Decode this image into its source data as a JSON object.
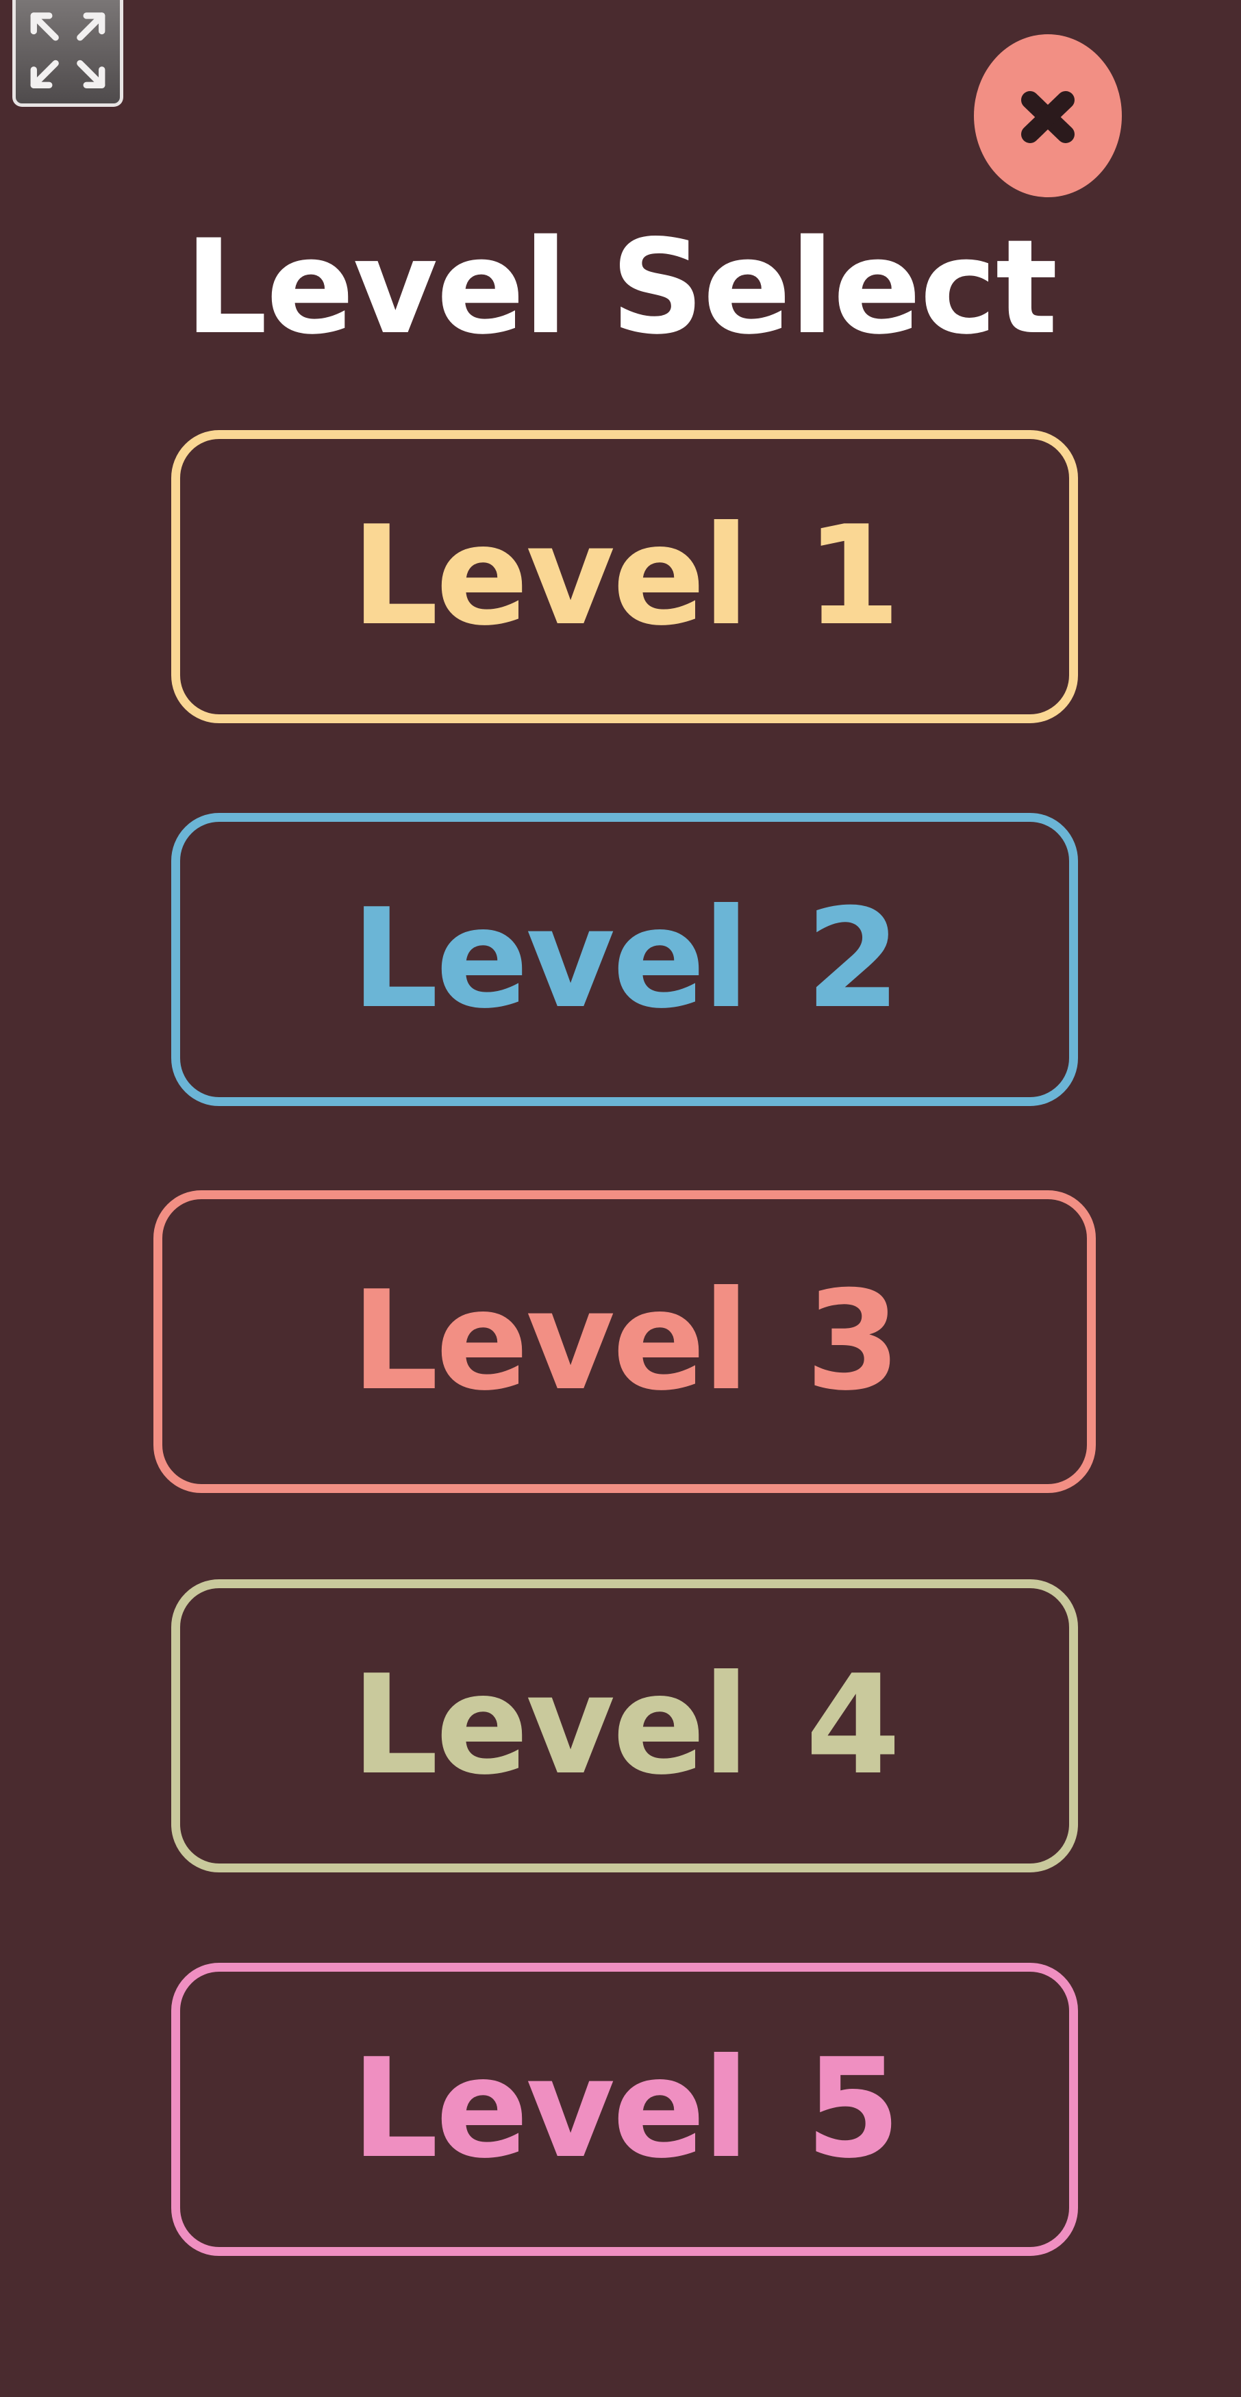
{
  "title": "Level Select",
  "fullscreen": {
    "icon": "fullscreen-expand-icon"
  },
  "close": {
    "icon": "close-x-icon",
    "color": "#f28f84"
  },
  "levels": [
    {
      "label": "Level 1",
      "color": "#fad794"
    },
    {
      "label": "Level 2",
      "color": "#6bb5d6"
    },
    {
      "label": "Level 3",
      "color": "#f28f84"
    },
    {
      "label": "Level 4",
      "color": "#c9c99c"
    },
    {
      "label": "Level 5",
      "color": "#ef8fc1"
    }
  ],
  "colors": {
    "background": "#4a2b2f",
    "title": "#ffffff"
  }
}
